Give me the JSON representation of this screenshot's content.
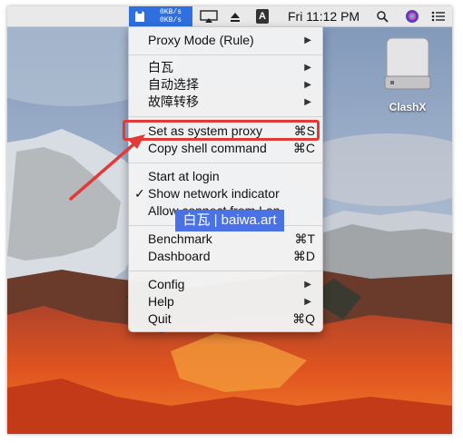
{
  "menubar": {
    "clash_speed_up": "0KB/s",
    "clash_speed_down": "0KB/s",
    "clock": "Fri 11:12 PM",
    "accessibility_letter": "A"
  },
  "desktop": {
    "drive_label": "ClashX"
  },
  "menu": {
    "proxy_mode": "Proxy Mode (Rule)",
    "group1": "白瓦",
    "group2": "自动选择",
    "group3": "故障转移",
    "set_system_proxy": "Set as system proxy",
    "set_system_proxy_shortcut": "⌘S",
    "copy_shell": "Copy shell command",
    "copy_shell_shortcut": "⌘C",
    "start_at_login": "Start at login",
    "show_network": "Show network indicator",
    "allow_connect": "Allow connect from Lan",
    "benchmark": "Benchmark",
    "benchmark_shortcut": "⌘T",
    "dashboard": "Dashboard",
    "dashboard_shortcut": "⌘D",
    "config": "Config",
    "help": "Help",
    "quit": "Quit",
    "quit_shortcut": "⌘Q",
    "check_mark": "✓",
    "submenu_arrow": "▶"
  },
  "watermark": {
    "text": "白瓦 | baiwa.art"
  },
  "colors": {
    "highlight": "#e03a3a",
    "clash_accent": "#2f6fe0",
    "watermark_bg": "#4a72e6"
  },
  "icons": [
    "clash-cat-icon",
    "airplay-icon",
    "eject-icon",
    "input-source-icon",
    "spotlight-search-icon",
    "siri-icon",
    "notification-center-icon",
    "hard-drive-icon",
    "annotation-arrow-icon"
  ]
}
